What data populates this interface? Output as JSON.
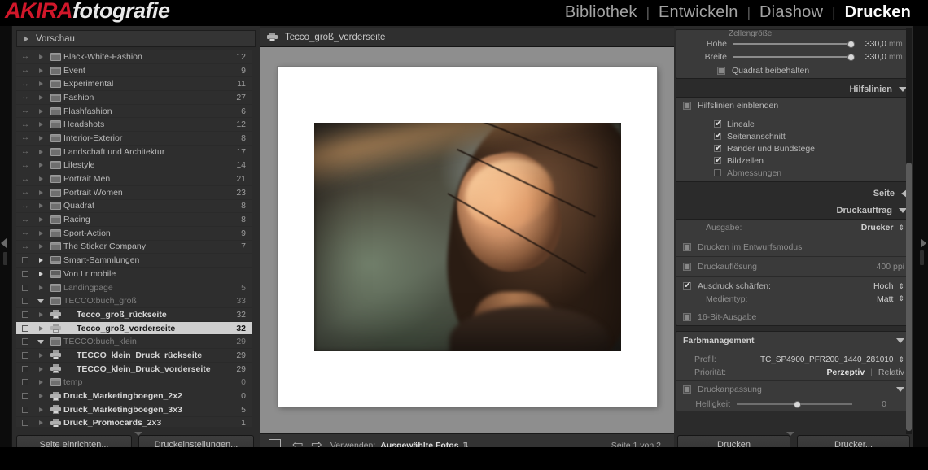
{
  "app": {
    "logo_primary": "AKIRA",
    "logo_secondary": "fotografie"
  },
  "module_nav": {
    "items": [
      {
        "label": "Bibliothek",
        "active": false
      },
      {
        "label": "Entwickeln",
        "active": false
      },
      {
        "label": "Diashow",
        "active": false
      },
      {
        "label": "Drucken",
        "active": true
      }
    ],
    "separator": "|"
  },
  "left_panel": {
    "preview_panel": {
      "label": "Vorschau",
      "expanded": false
    },
    "collections": [
      {
        "name": "Black-White-Fashion",
        "count": "12",
        "type": "folder",
        "indent": 0,
        "selected": false,
        "dim": false
      },
      {
        "name": "Event",
        "count": "9",
        "type": "folder",
        "indent": 0,
        "selected": false,
        "dim": false
      },
      {
        "name": "Experimental",
        "count": "11",
        "type": "folder",
        "indent": 0,
        "selected": false,
        "dim": false
      },
      {
        "name": "Fashion",
        "count": "27",
        "type": "folder",
        "indent": 0,
        "selected": false,
        "dim": false
      },
      {
        "name": "Flashfashion",
        "count": "6",
        "type": "folder",
        "indent": 0,
        "selected": false,
        "dim": false
      },
      {
        "name": "Headshots",
        "count": "12",
        "type": "folder",
        "indent": 0,
        "selected": false,
        "dim": false
      },
      {
        "name": "Interior-Exterior",
        "count": "8",
        "type": "folder",
        "indent": 0,
        "selected": false,
        "dim": false
      },
      {
        "name": "Landschaft und Architektur",
        "count": "17",
        "type": "folder",
        "indent": 0,
        "selected": false,
        "dim": false
      },
      {
        "name": "Lifestyle",
        "count": "14",
        "type": "folder",
        "indent": 0,
        "selected": false,
        "dim": false
      },
      {
        "name": "Portrait Men",
        "count": "21",
        "type": "folder",
        "indent": 0,
        "selected": false,
        "dim": false
      },
      {
        "name": "Portrait Women",
        "count": "23",
        "type": "folder",
        "indent": 0,
        "selected": false,
        "dim": false
      },
      {
        "name": "Quadrat",
        "count": "8",
        "type": "folder",
        "indent": 0,
        "selected": false,
        "dim": false
      },
      {
        "name": "Racing",
        "count": "8",
        "type": "folder",
        "indent": 0,
        "selected": false,
        "dim": false
      },
      {
        "name": "Sport-Action",
        "count": "9",
        "type": "folder",
        "indent": 0,
        "selected": false,
        "dim": false
      },
      {
        "name": "The Sticker Company",
        "count": "7",
        "type": "folder",
        "indent": 0,
        "selected": false,
        "dim": false
      },
      {
        "name": "Smart-Sammlungen",
        "count": "",
        "type": "smart",
        "indent": 0,
        "selected": false,
        "dim": false
      },
      {
        "name": "Von Lr mobile",
        "count": "",
        "type": "smart",
        "indent": 0,
        "selected": false,
        "dim": false
      },
      {
        "name": "Landingpage",
        "count": "5",
        "type": "folder",
        "indent": 0,
        "selected": false,
        "dim": true
      },
      {
        "name": "TECCO:buch_groß",
        "count": "33",
        "type": "folder-open",
        "indent": 0,
        "selected": false,
        "dim": true
      },
      {
        "name": "Tecco_groß_rückseite",
        "count": "32",
        "type": "print",
        "indent": 1,
        "selected": false,
        "dim": false
      },
      {
        "name": "Tecco_groß_vorderseite",
        "count": "32",
        "type": "print",
        "indent": 1,
        "selected": true,
        "dim": false
      },
      {
        "name": "TECCO:buch_klein",
        "count": "29",
        "type": "folder-open",
        "indent": 0,
        "selected": false,
        "dim": true
      },
      {
        "name": "TECCO_klein_Druck_rückseite",
        "count": "29",
        "type": "print",
        "indent": 1,
        "selected": false,
        "dim": false
      },
      {
        "name": "TECCO_klein_Druck_vorderseite",
        "count": "29",
        "type": "print",
        "indent": 1,
        "selected": false,
        "dim": false
      },
      {
        "name": "temp",
        "count": "0",
        "type": "folder",
        "indent": 0,
        "selected": false,
        "dim": true
      },
      {
        "name": "Druck_Marketingboegen_2x2",
        "count": "0",
        "type": "print",
        "indent": 0,
        "selected": false,
        "dim": false
      },
      {
        "name": "Druck_Marketingboegen_3x3",
        "count": "5",
        "type": "print",
        "indent": 0,
        "selected": false,
        "dim": false
      },
      {
        "name": "Druck_Promocards_2x3",
        "count": "1",
        "type": "print",
        "indent": 0,
        "selected": false,
        "dim": false
      }
    ],
    "buttons": {
      "page_setup": "Seite einrichten...",
      "print_settings": "Druckeinstellungen..."
    }
  },
  "center": {
    "header_title": "Tecco_groß_vorderseite",
    "header_icon": "printer-icon",
    "toolbar": {
      "use_label": "Verwenden:",
      "use_value": "Ausgewählte Fotos",
      "page_indicator": "Seite 1 von 2",
      "prev_icon": "arrow-left-icon",
      "next_icon": "arrow-right-icon"
    }
  },
  "right_panel": {
    "cell_size": {
      "title": "Zellengröße",
      "height": {
        "label": "Höhe",
        "value": "330,0",
        "unit": "mm",
        "position_pct": 97
      },
      "width": {
        "label": "Breite",
        "value": "330,0",
        "unit": "mm",
        "position_pct": 97
      },
      "keep_square": {
        "label": "Quadrat beibehalten",
        "checked": false
      }
    },
    "guides": {
      "title": "Hilfslinien",
      "expanded": true,
      "show_guides": {
        "label": "Hilfslinien einblenden",
        "checked": false
      },
      "options": [
        {
          "label": "Lineale",
          "checked": true
        },
        {
          "label": "Seitenanschnitt",
          "checked": true
        },
        {
          "label": "Ränder und Bundstege",
          "checked": true
        },
        {
          "label": "Bildzellen",
          "checked": true
        },
        {
          "label": "Abmessungen",
          "checked": false
        }
      ]
    },
    "page": {
      "title": "Seite",
      "expanded": false
    },
    "print_job": {
      "title": "Druckauftrag",
      "expanded": true,
      "output": {
        "label": "Ausgabe:",
        "value": "Drucker"
      },
      "draft_mode": {
        "label": "Drucken im Entwurfsmodus",
        "checked": false
      },
      "resolution": {
        "label": "Druckauflösung",
        "value": "400 ppi",
        "checked": false
      },
      "sharpen": {
        "label": "Ausdruck schärfen:",
        "value": "Hoch",
        "checked": true
      },
      "media_type": {
        "label": "Medientyp:",
        "value": "Matt"
      },
      "sixteen_bit": {
        "label": "16-Bit-Ausgabe",
        "checked": false
      }
    },
    "color_management": {
      "title": "Farbmanagement",
      "expanded": true,
      "profile": {
        "label": "Profil:",
        "value": "TC_SP4900_PFR200_1440_281010"
      },
      "intent": {
        "label": "Priorität:",
        "option_a": "Perzeptiv",
        "option_b": "Relativ",
        "selected": "Perzeptiv",
        "separator": "|"
      },
      "print_adjustment": {
        "label": "Druckanpassung",
        "checked": false
      },
      "brightness": {
        "label": "Helligkeit",
        "value": "0",
        "position_pct": 50
      }
    },
    "buttons": {
      "print": "Drucken",
      "printer": "Drucker..."
    }
  }
}
